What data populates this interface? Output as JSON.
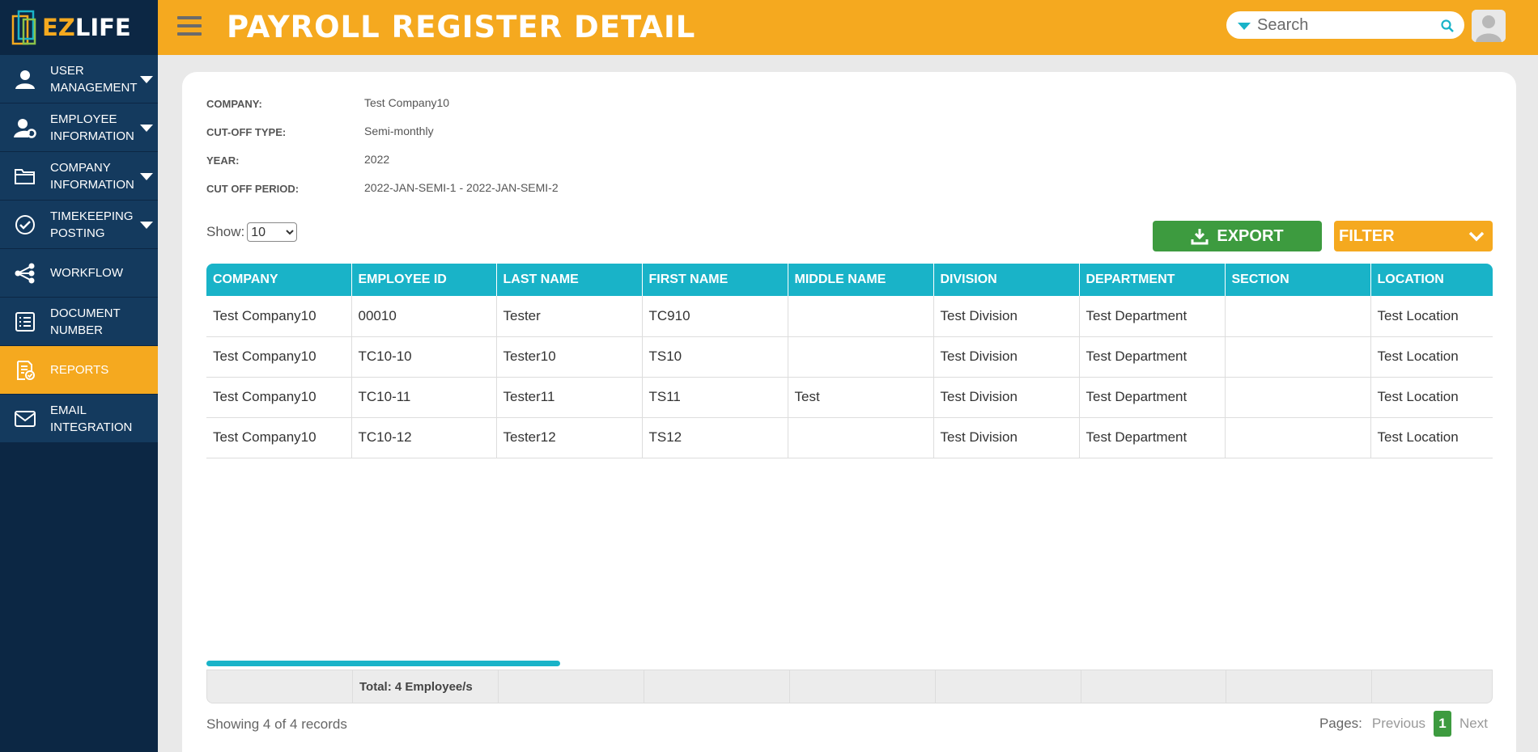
{
  "app": {
    "logo_ez": "EZ",
    "logo_life": "LIFE",
    "page_title": "PAYROLL REGISTER DETAIL",
    "accent": "#f5a91f",
    "sidebar_bg": "#0c2744",
    "table_header_color": "#19b3c8",
    "export_color": "#3d9b3f"
  },
  "search": {
    "placeholder": "Search"
  },
  "sidebar": {
    "items": [
      {
        "label": "USER MANAGEMENT",
        "icon": "user-icon",
        "caret": true
      },
      {
        "label": "EMPLOYEE INFORMATION",
        "icon": "user-gear-icon",
        "caret": true
      },
      {
        "label": "COMPANY INFORMATION",
        "icon": "folder-icon",
        "caret": true
      },
      {
        "label": "TIMEKEEPING POSTING",
        "icon": "check-circle-icon",
        "caret": true
      },
      {
        "label": "WORKFLOW",
        "icon": "workflow-icon",
        "caret": false
      },
      {
        "label": "DOCUMENT NUMBER",
        "icon": "list-icon",
        "caret": false
      },
      {
        "label": "REPORTS",
        "icon": "report-icon",
        "caret": false,
        "active": true
      },
      {
        "label": "EMAIL INTEGRATION",
        "icon": "mail-icon",
        "caret": false
      }
    ]
  },
  "meta": {
    "company_label": "COMPANY:",
    "company_value": "Test Company10",
    "cutoff_type_label": "CUT-OFF TYPE:",
    "cutoff_type_value": "Semi-monthly",
    "year_label": "YEAR:",
    "year_value": "2022",
    "cutoff_period_label": "CUT OFF PERIOD:",
    "cutoff_period_value": "2022-JAN-SEMI-1 - 2022-JAN-SEMI-2"
  },
  "controls": {
    "show_label": "Show:",
    "show_value": "10",
    "export_label": "EXPORT",
    "filter_label": "FILTER"
  },
  "table": {
    "columns": [
      "COMPANY",
      "EMPLOYEE ID",
      "LAST NAME",
      "FIRST NAME",
      "MIDDLE NAME",
      "DIVISION",
      "DEPARTMENT",
      "SECTION",
      "LOCATION"
    ],
    "rows": [
      [
        "Test Company10",
        "00010",
        "Tester",
        "TC910",
        "",
        "Test Division",
        "Test Department",
        "",
        "Test Location"
      ],
      [
        "Test Company10",
        "TC10-10",
        "Tester10",
        "TS10",
        "",
        "Test Division",
        "Test Department",
        "",
        "Test Location"
      ],
      [
        "Test Company10",
        "TC10-11",
        "Tester11",
        "TS11",
        "Test",
        "Test Division",
        "Test Department",
        "",
        "Test Location"
      ],
      [
        "Test Company10",
        "TC10-12",
        "Tester12",
        "TS12",
        "",
        "Test Division",
        "Test Department",
        "",
        "Test Location"
      ]
    ],
    "total_label": "Total: 4 Employee/s"
  },
  "pagination": {
    "showing": "Showing 4 of 4 records",
    "pages_label": "Pages:",
    "previous": "Previous",
    "current": "1",
    "next": "Next"
  }
}
